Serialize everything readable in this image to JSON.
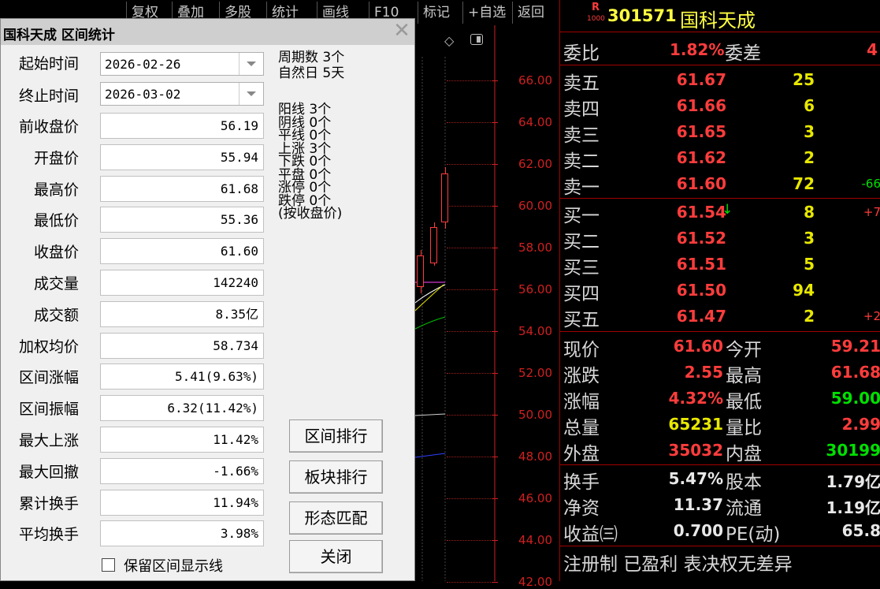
{
  "toolbar": {
    "items": [
      "复权",
      "叠加",
      "多股",
      "统计",
      "画线",
      "F10",
      "标记",
      "+自选",
      "返回"
    ]
  },
  "stock": {
    "badge_top": "R",
    "badge_bottom": "1000",
    "code": "301571",
    "name": "国科天成"
  },
  "chart": {
    "icons": [
      "diamond-icon",
      "window-toggle-icon"
    ],
    "price_labels": [
      "66.00",
      "64.00",
      "62.00",
      "60.00",
      "58.00",
      "56.00",
      "54.00",
      "52.00",
      "50.00",
      "48.00",
      "46.00",
      "44.00",
      "42.00"
    ]
  },
  "quote": {
    "weibi": {
      "label": "委比",
      "value": "1.82%",
      "label2": "委差",
      "value2": "4"
    },
    "sell": [
      {
        "label": "卖五",
        "price": "61.67",
        "volume": "25",
        "change": ""
      },
      {
        "label": "卖四",
        "price": "61.66",
        "volume": "6",
        "change": ""
      },
      {
        "label": "卖三",
        "price": "61.65",
        "volume": "3",
        "change": ""
      },
      {
        "label": "卖二",
        "price": "61.62",
        "volume": "2",
        "change": ""
      },
      {
        "label": "卖一",
        "price": "61.60",
        "volume": "72",
        "change": "-66"
      }
    ],
    "buy": [
      {
        "label": "买一",
        "price": "61.54",
        "volume": "8",
        "change": "+7"
      },
      {
        "label": "买二",
        "price": "61.52",
        "volume": "3",
        "change": ""
      },
      {
        "label": "买三",
        "price": "61.51",
        "volume": "5",
        "change": ""
      },
      {
        "label": "买四",
        "price": "61.50",
        "volume": "94",
        "change": ""
      },
      {
        "label": "买五",
        "price": "61.47",
        "volume": "2",
        "change": "+2"
      }
    ],
    "stats": [
      {
        "l1": "现价",
        "v1": "61.60",
        "l2": "今开",
        "v2": "59.21"
      },
      {
        "l1": "涨跌",
        "v1": "2.55",
        "l2": "最高",
        "v2": "61.68"
      },
      {
        "l1": "涨幅",
        "v1": "4.32%",
        "l2": "最低",
        "v2": "59.00"
      },
      {
        "l1": "总量",
        "v1": "65231",
        "l2": "量比",
        "v2": "2.99"
      },
      {
        "l1": "外盘",
        "v1": "35032",
        "l2": "内盘",
        "v2": "30199"
      }
    ],
    "fin": [
      {
        "l1": "换手",
        "v1": "5.47%",
        "l2": "股本",
        "v2": "1.79亿"
      },
      {
        "l1": "净资",
        "v1": "11.37",
        "l2": "流通",
        "v2": "1.19亿"
      },
      {
        "l1": "收益㈢",
        "v1": "0.700",
        "l2": "PE(动)",
        "v2": "65.8"
      }
    ],
    "footer": "注册制 已盈利 表决权无差异",
    "colors": {
      "red": "#ff3c3c",
      "green": "#00e000",
      "yellow": "#e8e800",
      "frame": "#a00000"
    }
  },
  "dialog": {
    "title": "国科天成 区间统计",
    "start_label": "起始时间",
    "start_value": "2026-02-26",
    "end_label": "终止时间",
    "end_value": "2026-03-02",
    "fields": [
      {
        "label": "前收盘价",
        "value": "56.19"
      },
      {
        "label": "开盘价",
        "value": "55.94"
      },
      {
        "label": "最高价",
        "value": "61.68"
      },
      {
        "label": "最低价",
        "value": "55.36"
      },
      {
        "label": "收盘价",
        "value": "61.60"
      },
      {
        "label": "成交量",
        "value": "142240"
      },
      {
        "label": "成交额",
        "value": "8.35亿"
      },
      {
        "label": "加权均价",
        "value": "58.734"
      },
      {
        "label": "区间涨幅",
        "value": "5.41(9.63%)"
      },
      {
        "label": "区间振幅",
        "value": "6.32(11.42%)"
      },
      {
        "label": "最大上涨",
        "value": "11.42%"
      },
      {
        "label": "最大回撤",
        "value": "-1.66%"
      },
      {
        "label": "累计换手",
        "value": "11.94%"
      },
      {
        "label": "平均换手",
        "value": "3.98%"
      }
    ],
    "period_lines": [
      "周期数 3个",
      "自然日 5天"
    ],
    "count_lines": [
      "阳线 3个",
      "阴线 0个",
      "平线 0个",
      "上涨 3个",
      "下跌 0个",
      "平盘 0个",
      "涨停 0个",
      "跌停 0个",
      "(按收盘价)"
    ],
    "buttons": [
      "区间排行",
      "板块排行",
      "形态匹配",
      "关闭"
    ],
    "checkbox_label": "保留区间显示线",
    "checkbox_checked": false
  }
}
